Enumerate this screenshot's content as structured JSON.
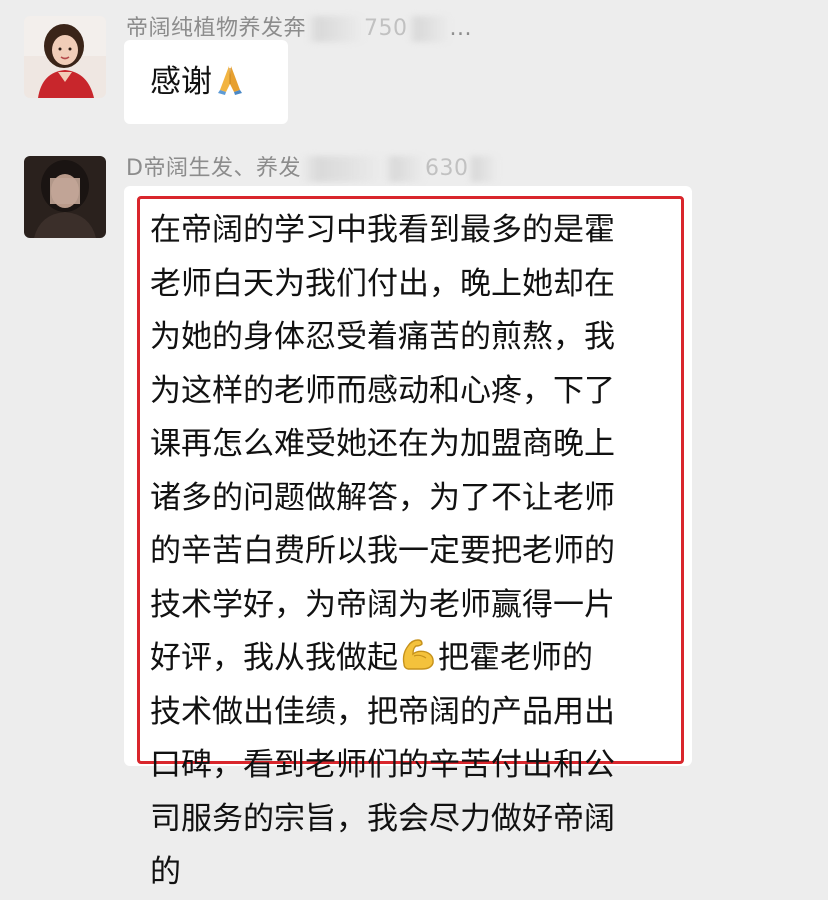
{
  "messages": [
    {
      "sender_visible": "帝阔纯植物养发奔",
      "sender_visible_tail": "750",
      "sender_visible_end": "...",
      "text": "感谢",
      "emoji": "folded-hands-icon"
    },
    {
      "sender_visible": "D帝阔生发、养发",
      "sender_visible_tail": "630",
      "lines": [
        "在帝阔的学习中我看到最多的是霍",
        "老师白天为我们付出，晚上她却在",
        "为她的身体忍受着痛苦的煎熬，我",
        "为这样的老师而感动和心疼，下了",
        "课再怎么难受她还在为加盟商晚上",
        "诸多的问题做解答，为了不让老师",
        "的辛苦白费所以我一定要把老师的",
        "技术学好，为帝阔为老师赢得一片",
        "好评，我从我做起",
        "技术做出佳绩，把帝阔的产品用出",
        "口碑，看到老师们的辛苦付出和公",
        "司服务的宗旨，我会尽力做好帝阔",
        "的"
      ],
      "line9_after_emoji": "把霍老师的",
      "emoji_inline": "flexed-biceps-icon"
    }
  ],
  "colors": {
    "background": "#ededed",
    "bubble": "#ffffff",
    "highlight_border": "#d9262c",
    "sender_text": "#8c8c8c"
  }
}
